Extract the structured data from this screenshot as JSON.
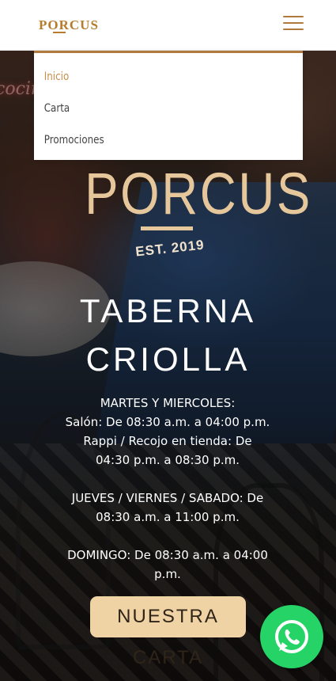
{
  "header": {
    "brand": "PORCUS",
    "menu_icon": "hamburger-menu-icon"
  },
  "nav": {
    "items": [
      {
        "label": "Inicio",
        "active": true
      },
      {
        "label": "Carta",
        "active": false
      },
      {
        "label": "Promociones",
        "active": false
      }
    ]
  },
  "hero": {
    "logo_word": "PORCUS",
    "logo_est": "EST. 2019",
    "title_line1": "TABERNA",
    "title_line2": "CRIOLLA",
    "hours": {
      "line1": "MARTES Y MIERCOLES:",
      "line2": "Salón: De 08:30 a.m. a 04:00 p.m.",
      "line3": "Rappi / Recojo en tienda: De 04:30 p.m. a 08:30 p.m.",
      "line4": "JUEVES / VIERNES / SABADO: De 08:30 a.m. a 11:00 p.m.",
      "line5": "DOMINGO: De 08:30 a.m. a 04:00 p.m."
    },
    "cta_label": "NUESTRA CARTA",
    "neon_text": "cocin"
  },
  "floating": {
    "whatsapp_icon": "whatsapp-icon"
  },
  "colors": {
    "accent": "#c98e4a",
    "cta_bg": "#f0d3a5",
    "whatsapp": "#25d366"
  }
}
